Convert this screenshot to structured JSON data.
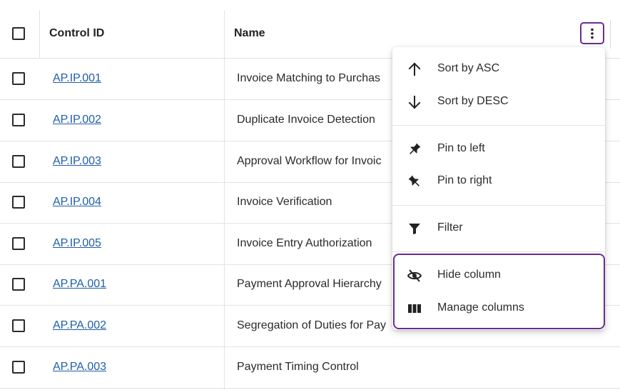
{
  "table": {
    "columns": {
      "control_id": "Control ID",
      "name": "Name"
    },
    "rows": [
      {
        "id": "AP.IP.001",
        "name": "Invoice Matching to Purchas"
      },
      {
        "id": "AP.IP.002",
        "name": "Duplicate Invoice Detection"
      },
      {
        "id": "AP.IP.003",
        "name": "Approval Workflow for Invoic"
      },
      {
        "id": "AP.IP.004",
        "name": "Invoice Verification"
      },
      {
        "id": "AP.IP.005",
        "name": "Invoice Entry Authorization"
      },
      {
        "id": "AP.PA.001",
        "name": "Payment Approval Hierarchy"
      },
      {
        "id": "AP.PA.002",
        "name": "Segregation of Duties for Pay"
      },
      {
        "id": "AP.PA.003",
        "name": "Payment Timing Control"
      }
    ]
  },
  "column_menu": {
    "trigger_icon": "kebab-vertical-icon",
    "items": [
      {
        "label": "Sort by ASC",
        "icon": "arrow-up-icon"
      },
      {
        "label": "Sort by DESC",
        "icon": "arrow-down-icon"
      },
      {
        "label": "Pin to left",
        "icon": "pin-left-icon"
      },
      {
        "label": "Pin to right",
        "icon": "pin-right-icon"
      },
      {
        "label": "Filter",
        "icon": "filter-icon"
      },
      {
        "label": "Hide column",
        "icon": "eye-slash-icon"
      },
      {
        "label": "Manage columns",
        "icon": "columns-icon"
      }
    ]
  },
  "colors": {
    "link": "#1f5fa8",
    "highlight": "#6b2c91"
  }
}
